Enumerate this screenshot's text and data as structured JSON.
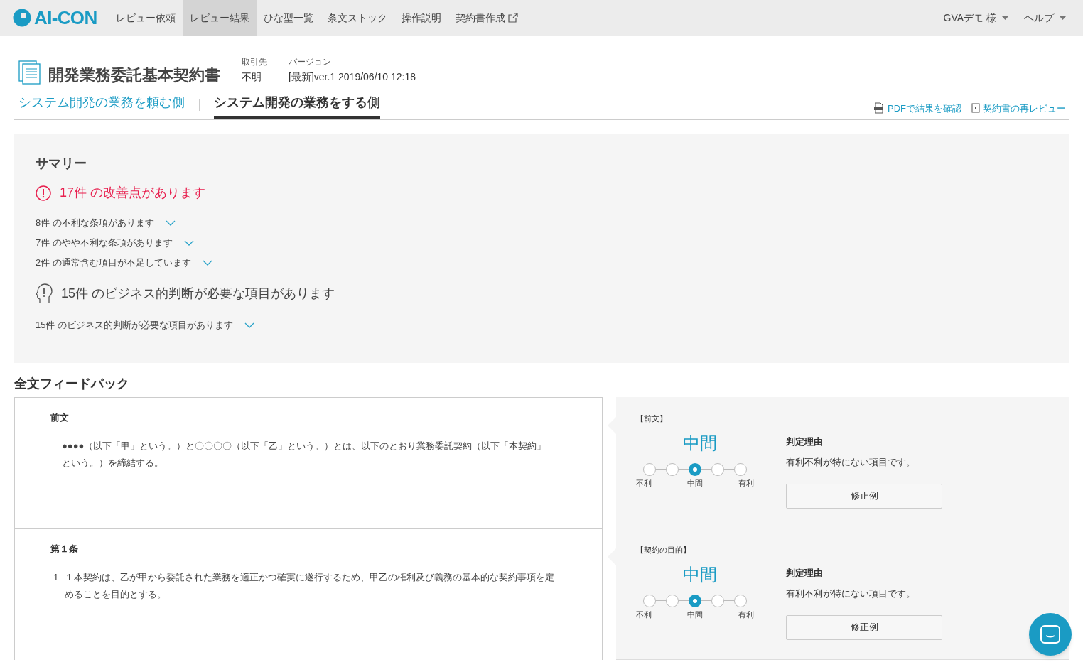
{
  "nav": {
    "logo": "AI-CON",
    "items": [
      {
        "label": "レビュー依頼",
        "selected": false,
        "external": false
      },
      {
        "label": "レビュー結果",
        "selected": true,
        "external": false
      },
      {
        "label": "ひな型一覧",
        "selected": false,
        "external": false
      },
      {
        "label": "条文ストック",
        "selected": false,
        "external": false
      },
      {
        "label": "操作説明",
        "selected": false,
        "external": false
      },
      {
        "label": "契約書作成",
        "selected": false,
        "external": true
      }
    ],
    "right": [
      "GVAデモ 様",
      "ヘルプ"
    ]
  },
  "document": {
    "title": "開発業務委託基本契約書",
    "meta": [
      {
        "label": "取引先",
        "value": "不明"
      },
      {
        "label": "バージョン",
        "value": "[最新]ver.1 2019/06/10 12:18"
      }
    ]
  },
  "tabs": [
    {
      "label": "システム開発の業務を頼む側",
      "selected": false
    },
    {
      "label": "システム開発の業務をする側",
      "selected": true
    }
  ],
  "actions": [
    "PDFで結果を確認",
    "契約書の再レビュー"
  ],
  "summary": {
    "title": "サマリー",
    "groups": [
      {
        "kind": "warning",
        "headline": "17件 の改善点があります",
        "items": [
          "8件 の不利な条項があります",
          "7件 のやや不利な条項があります",
          "2件 の通常含む項目が不足しています"
        ]
      },
      {
        "kind": "judgment",
        "headline": "15件 のビジネス的判断が必要な項目があります",
        "items": [
          "15件 のビジネス的判断が必要な項目があります"
        ]
      }
    ]
  },
  "feedback": {
    "title": "全文フィードバック",
    "rows": [
      {
        "heading": "前文",
        "number": "",
        "text": "●●●●（以下「甲」という。）と〇〇〇〇（以下「乙」という。）とは、以下のとおり業務委託契約（以下「本契約」という。）を締結する。",
        "section": "【前文】",
        "rating": "中間",
        "points": [
          {
            "selected": false
          },
          {
            "selected": false
          },
          {
            "selected": true
          },
          {
            "selected": false
          },
          {
            "selected": false
          }
        ],
        "scale_labels": [
          "不利",
          "中間",
          "有利"
        ],
        "reason_title": "判定理由",
        "reason": "有利不利が特にない項目です。",
        "button": "修正例"
      },
      {
        "heading": "第１条",
        "number": "1",
        "text": "１本契約は、乙が甲から委託された業務を適正かつ確実に遂行するため、甲乙の権利及び義務の基本的な契約事項を定めることを目的とする。",
        "section": "【契約の目的】",
        "rating": "中間",
        "points": [
          {
            "selected": false
          },
          {
            "selected": false
          },
          {
            "selected": true
          },
          {
            "selected": false
          },
          {
            "selected": false
          }
        ],
        "scale_labels": [
          "不利",
          "中間",
          "有利"
        ],
        "reason_title": "判定理由",
        "reason": "有利不利が特にない項目です。",
        "button": "修正例"
      }
    ]
  }
}
